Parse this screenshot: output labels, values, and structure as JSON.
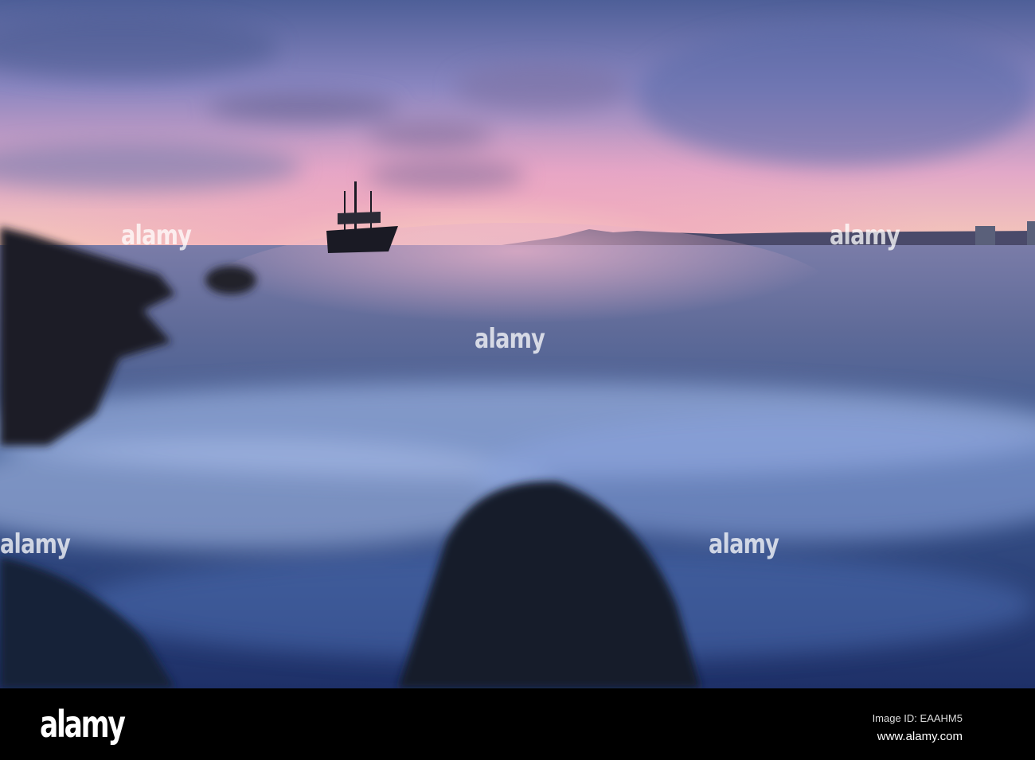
{
  "photo": {
    "subject": "pirate-ship-at-sunset",
    "colors": {
      "sky_top": "#5a6aa0",
      "sunset_pink": "#f0a8c0",
      "sunset_glow": "#f8d0b0",
      "water": "#3a5580",
      "foam": "#a8c0e8",
      "rock": "#1a1e2c"
    }
  },
  "watermark": {
    "text": "alamy"
  },
  "footer": {
    "logo": "alamy",
    "image_id": "Image ID: EAAHM5",
    "website": "www.alamy.com"
  }
}
